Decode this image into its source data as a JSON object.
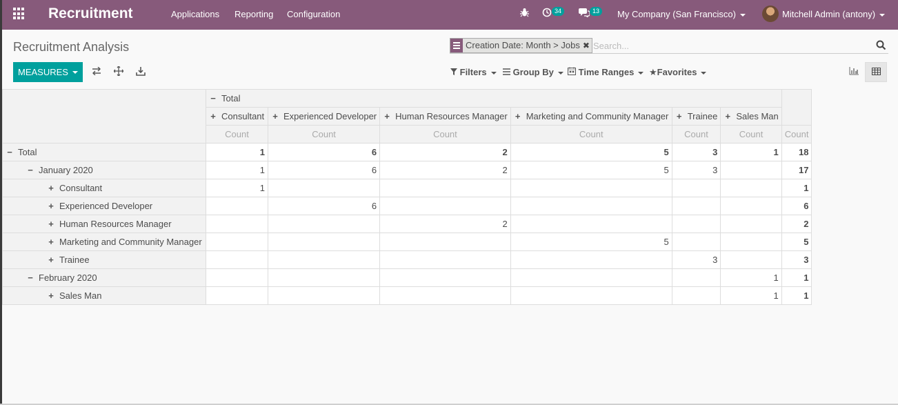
{
  "navbar": {
    "brand": "Recruitment",
    "menu": [
      "Applications",
      "Reporting",
      "Configuration"
    ],
    "activity_count": "34",
    "messages_count": "13",
    "company": "My Company (San Francisco)",
    "user": "Mitchell Admin (antony)"
  },
  "page": {
    "title": "Recruitment Analysis",
    "search": {
      "facet": "Creation Date: Month > Jobs",
      "placeholder": "Search..."
    },
    "measures_label": "MEASURES",
    "filters_label": "Filters",
    "groupby_label": "Group By",
    "timeranges_label": "Time Ranges",
    "favorites_label": "Favorites"
  },
  "pivot": {
    "col_group": "Total",
    "columns": [
      "Consultant",
      "Experienced Developer",
      "Human Resources Manager",
      "Marketing and Community Manager",
      "Trainee",
      "Sales Man"
    ],
    "measure": "Count",
    "rows": [
      {
        "label": "Total",
        "values": [
          "1",
          "6",
          "2",
          "5",
          "3",
          "1"
        ],
        "total": "18"
      },
      {
        "label": "January 2020",
        "values": [
          "1",
          "6",
          "2",
          "5",
          "3",
          ""
        ],
        "total": "17"
      },
      {
        "label": "Consultant",
        "values": [
          "1",
          "",
          "",
          "",
          "",
          ""
        ],
        "total": "1"
      },
      {
        "label": "Experienced Developer",
        "values": [
          "",
          "6",
          "",
          "",
          "",
          ""
        ],
        "total": "6"
      },
      {
        "label": "Human Resources Manager",
        "values": [
          "",
          "",
          "2",
          "",
          "",
          ""
        ],
        "total": "2"
      },
      {
        "label": "Marketing and Community Manager",
        "values": [
          "",
          "",
          "",
          "5",
          "",
          ""
        ],
        "total": "5"
      },
      {
        "label": "Trainee",
        "values": [
          "",
          "",
          "",
          "",
          "3",
          ""
        ],
        "total": "3"
      },
      {
        "label": "February 2020",
        "values": [
          "",
          "",
          "",
          "",
          "",
          "1"
        ],
        "total": "1"
      },
      {
        "label": "Sales Man",
        "values": [
          "",
          "",
          "",
          "",
          "",
          "1"
        ],
        "total": "1"
      }
    ]
  }
}
